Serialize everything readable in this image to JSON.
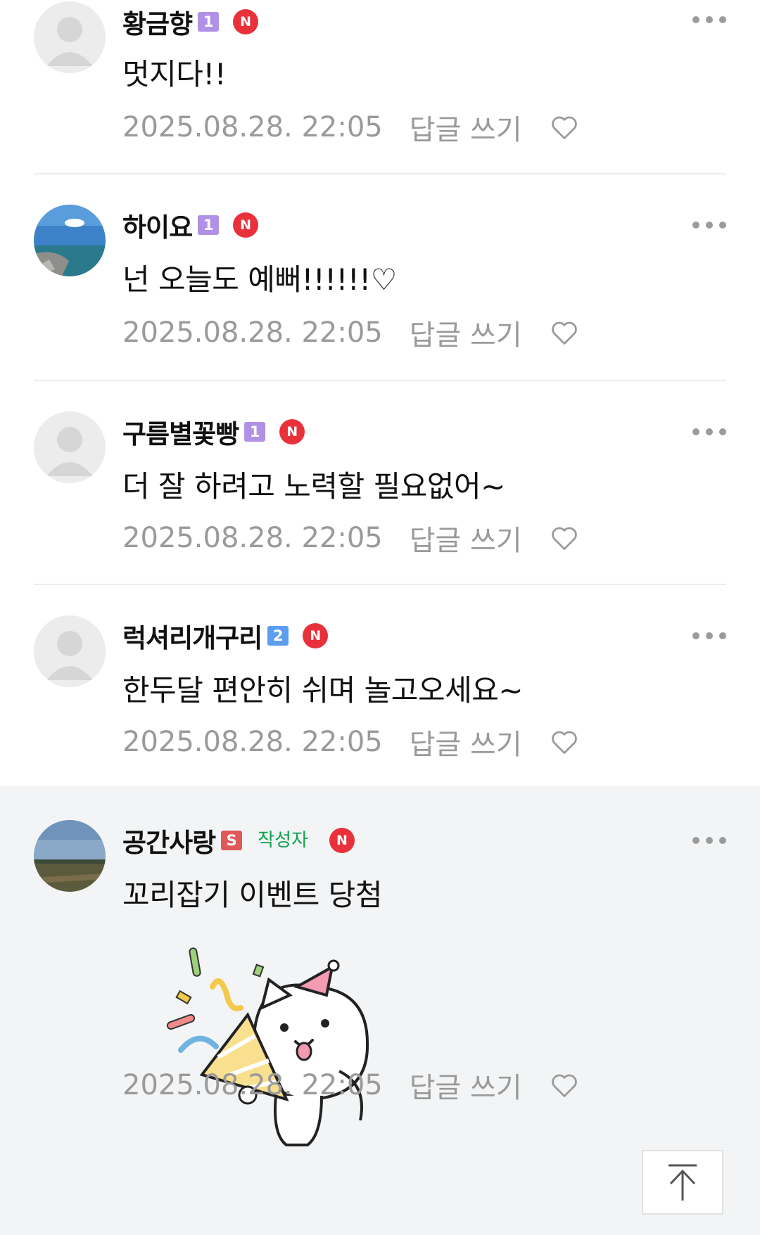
{
  "comments": [
    {
      "nickname": "황금향",
      "grade": "1",
      "new": "N",
      "content": "멋지다!!",
      "date": "2025.08.28. 22:05",
      "reply": "답글 쓰기"
    },
    {
      "nickname": "하이요",
      "grade": "1",
      "new": "N",
      "content": "넌 오늘도 예뻐!!!!!!♡",
      "date": "2025.08.28. 22:05",
      "reply": "답글 쓰기"
    },
    {
      "nickname": "구름별꽃빵",
      "grade": "1",
      "new": "N",
      "content": "더 잘 하려고 노력할 필요없어~",
      "date": "2025.08.28. 22:05",
      "reply": "답글 쓰기"
    },
    {
      "nickname": "럭셔리개구리",
      "grade": "2",
      "new": "N",
      "content": "한두달 편안히 쉬며 놀고오세요~",
      "date": "2025.08.28. 22:05",
      "reply": "답글 쓰기"
    },
    {
      "nickname": "공간사랑",
      "grade": "S",
      "writer": "작성자",
      "new": "N",
      "content": "꼬리잡기 이벤트 당첨",
      "date": "2025.08.28. 22:05",
      "reply": "답글 쓰기"
    }
  ],
  "colors": {
    "grade_1": "#b191e6",
    "grade_2": "#5b9ef0",
    "grade_s": "#e0595a",
    "new_badge": "#e8313a",
    "writer_tag": "#0aa34c",
    "author_bg": "#f3f4f5"
  },
  "icons": [
    "person-icon",
    "more-icon",
    "heart-icon",
    "new-badge-icon",
    "scroll-top-icon"
  ]
}
